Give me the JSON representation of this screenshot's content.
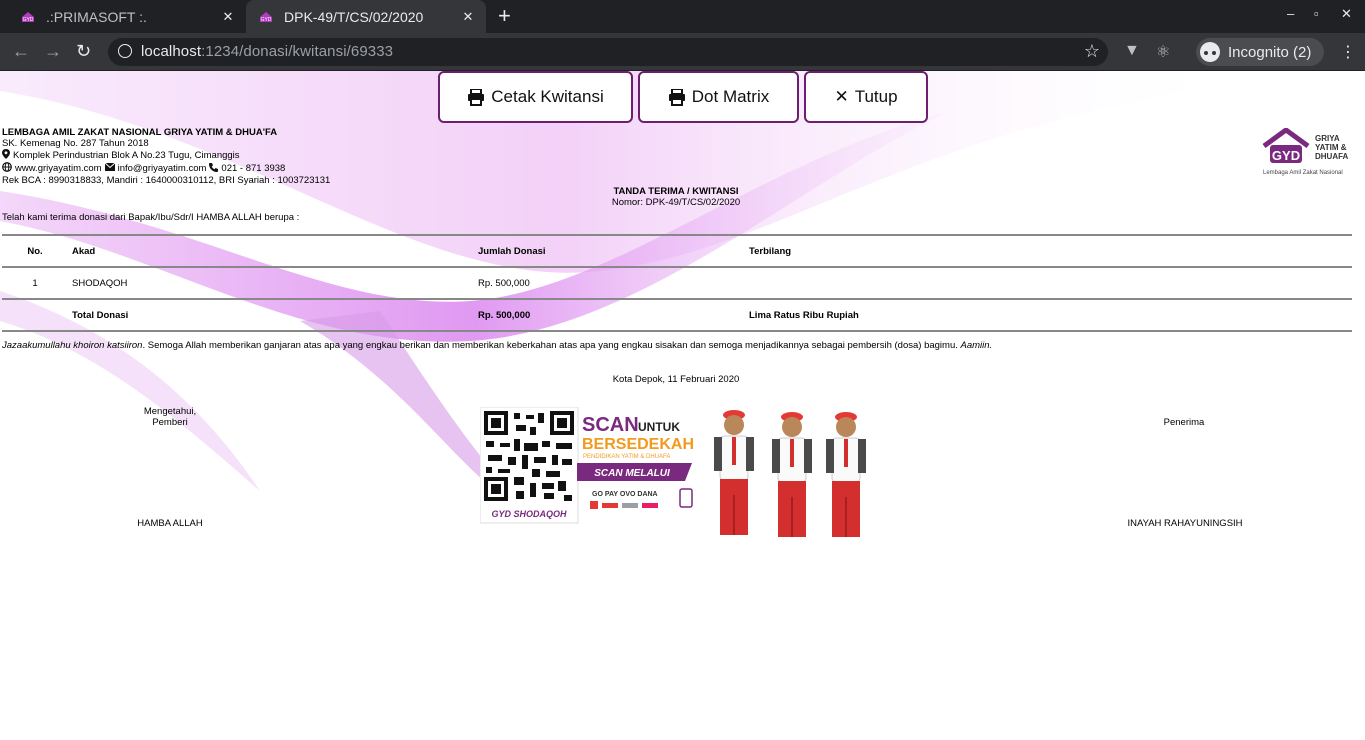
{
  "browser": {
    "tabs": [
      {
        "title": ".:PRIMASOFT :.",
        "active": false
      },
      {
        "title": "DPK-49/T/CS/02/2020",
        "active": true
      }
    ],
    "url_host": "localhost",
    "url_path": ":1234/donasi/kwitansi/69333",
    "profile_label": "Incognito (2)"
  },
  "actions": {
    "print_label": "Cetak Kwitansi",
    "dotmatrix_label": "Dot Matrix",
    "close_label": "Tutup"
  },
  "org": {
    "name": "LEMBAGA AMIL ZAKAT NASIONAL GRIYA YATIM & DHUA'FA",
    "decree": "SK. Kemenag No. 287 Tahun 2018",
    "address": "Komplek Perindustrian Blok A No.23 Tugu, Cimanggis",
    "website": "www.griyayatim.com",
    "email": "info@griyayatim.com",
    "phone": "021 - 871 3938",
    "accounts": "Rek BCA : 8990318833, Mandiri : 1640000310112, BRI Syariah : 1003723131",
    "logo_abbr": "GYD",
    "logo_line1": "GRIYA",
    "logo_line2": "YATIM &",
    "logo_line3": "DHUAFA",
    "logo_sub": "Lembaga Amil Zakat Nasional"
  },
  "receipt": {
    "title": "TANDA TERIMA / KWITANSI",
    "number": "Nomor: DPK-49/T/CS/02/2020",
    "intro": "Telah kami terima donasi dari Bapak/Ibu/Sdr/I HAMBA ALLAH berupa :",
    "columns": [
      "No.",
      "Akad",
      "Jumlah Donasi",
      "Terbilang"
    ],
    "rows": [
      {
        "no": "1",
        "akad": "SHODAQOH",
        "amount": "Rp. 500,000",
        "words": ""
      }
    ],
    "total_label": "Total Donasi",
    "total_amount": "Rp. 500,000",
    "total_words": "Lima Ratus Ribu Rupiah",
    "prayer_start": "Jazaakumullahu khoiron katsiiron",
    "prayer_middle": ". Semoga Allah memberikan ganjaran atas apa yang engkau berikan dan memberikan keberkahan atas apa yang engkau sisakan dan semoga menjadikannya sebagai pembersih (dosa) bagimu. ",
    "prayer_end": "Aamiin.",
    "place_date": "Kota Depok, 11 Februari 2020",
    "left_sig_line1": "Mengetahui,",
    "left_sig_line2": "Pemberi",
    "left_sig_name": "HAMBA ALLAH",
    "right_sig_title": "Penerima",
    "right_sig_name": "INAYAH RAHAYUNINGSIH"
  },
  "promo": {
    "scan": "SCAN",
    "untuk": "UNTUK",
    "bersedekah": "BERSEDEKAH",
    "tagline": "PENDIDIKAN YATIM & DHUAFA",
    "scan_via": "SCAN MELALUI",
    "qr_caption": "GYD SHODAQOH",
    "wallets": "GO PAY  OVO  DANA"
  },
  "colors": {
    "brand_purple": "#6b1f6e",
    "promo_orange": "#f29a1f",
    "accent_pink": "#e3a3ef"
  }
}
